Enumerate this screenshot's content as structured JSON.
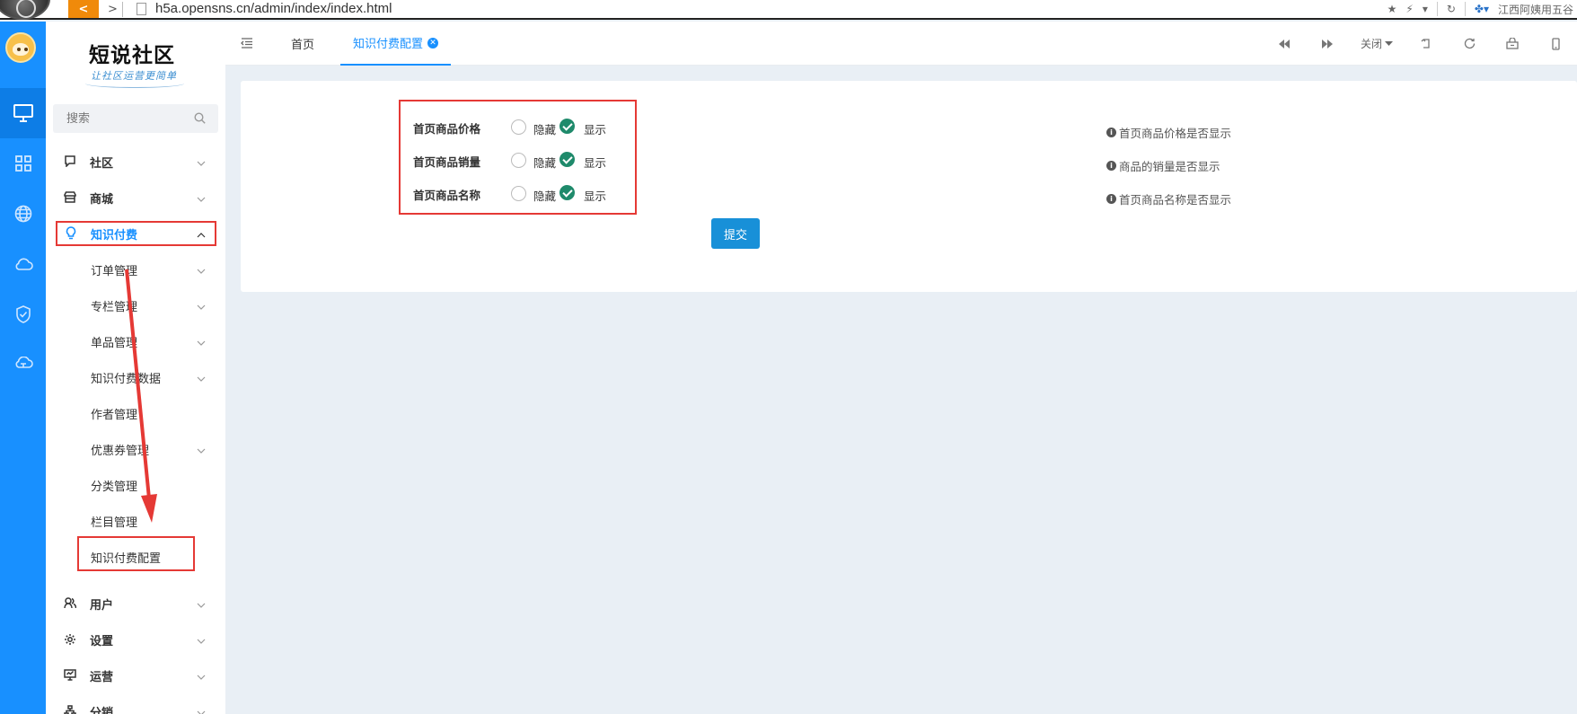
{
  "browser": {
    "url": "h5a.opensns.cn/admin/index/index.html",
    "right_text": "江西阿姨用五谷"
  },
  "brand": {
    "title": "短说社区",
    "subtitle": "让社区运营更简单"
  },
  "search": {
    "placeholder": "搜索"
  },
  "menu": {
    "items": [
      {
        "label": "社区"
      },
      {
        "label": "商城"
      },
      {
        "label": "知识付费"
      },
      {
        "label": "用户"
      },
      {
        "label": "设置"
      },
      {
        "label": "运营"
      },
      {
        "label": "分销"
      }
    ],
    "submenu": [
      {
        "label": "订单管理",
        "has_children": true
      },
      {
        "label": "专栏管理",
        "has_children": true
      },
      {
        "label": "单品管理",
        "has_children": true
      },
      {
        "label": "知识付费数据",
        "has_children": true
      },
      {
        "label": "作者管理",
        "has_children": false
      },
      {
        "label": "优惠券管理",
        "has_children": true
      },
      {
        "label": "分类管理",
        "has_children": false
      },
      {
        "label": "栏目管理",
        "has_children": false
      },
      {
        "label": "知识付费配置",
        "has_children": false
      }
    ]
  },
  "tabs": {
    "home": "首页",
    "active": "知识付费配置"
  },
  "toolbar": {
    "close_label": "关闭"
  },
  "form": {
    "rows": [
      {
        "label": "首页商品价格",
        "hide": "隐藏",
        "show": "显示",
        "selected": "显示",
        "hint": "首页商品价格是否显示"
      },
      {
        "label": "首页商品销量",
        "hide": "隐藏",
        "show": "显示",
        "selected": "显示",
        "hint": "商品的销量是否显示"
      },
      {
        "label": "首页商品名称",
        "hide": "隐藏",
        "show": "显示",
        "selected": "显示",
        "hint": "首页商品名称是否显示"
      }
    ],
    "submit_label": "提交"
  },
  "colors": {
    "primary": "#1890ff",
    "radio_checked": "#1f8a6b",
    "annotation": "#e53935"
  }
}
